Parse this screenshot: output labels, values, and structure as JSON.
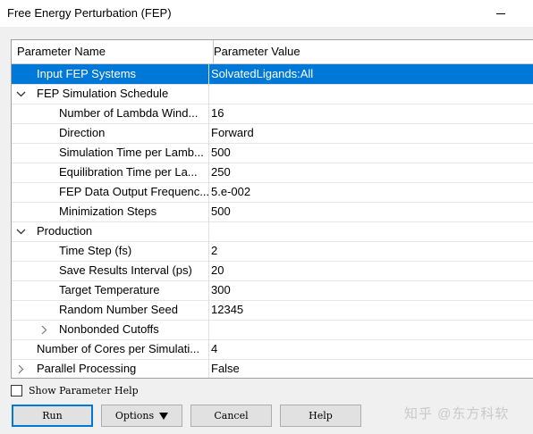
{
  "window": {
    "title": "Free Energy Perturbation (FEP)"
  },
  "table": {
    "headers": {
      "name": "Parameter Name",
      "value": "Parameter Value"
    },
    "rows": [
      {
        "name": "Input FEP Systems",
        "value": "SolvatedLigands:All",
        "selected": true
      },
      {
        "name": "FEP Simulation Schedule",
        "value": "",
        "group": "expanded"
      },
      {
        "name": "Number of Lambda Wind...",
        "value": "16"
      },
      {
        "name": "Direction",
        "value": "Forward"
      },
      {
        "name": "Simulation Time per Lamb...",
        "value": "500"
      },
      {
        "name": "Equilibration Time per La...",
        "value": "250"
      },
      {
        "name": "FEP Data Output Frequenc...",
        "value": "5.e-002"
      },
      {
        "name": "Minimization Steps",
        "value": "500"
      },
      {
        "name": "Production",
        "value": "",
        "group": "expanded"
      },
      {
        "name": "Time Step (fs)",
        "value": "2"
      },
      {
        "name": "Save Results Interval (ps)",
        "value": "20"
      },
      {
        "name": "Target Temperature",
        "value": "300"
      },
      {
        "name": "Random Number Seed",
        "value": "12345"
      },
      {
        "name": "Nonbonded Cutoffs",
        "value": "",
        "group": "collapsed"
      },
      {
        "name": "Number of Cores per Simulati...",
        "value": "4"
      },
      {
        "name": "Parallel Processing",
        "value": "False",
        "group": "collapsed"
      }
    ]
  },
  "show_help": {
    "label": "Show Parameter Help",
    "checked": false
  },
  "buttons": {
    "run": "Run",
    "options": "Options",
    "cancel": "Cancel",
    "help": "Help"
  },
  "watermark": "知乎 @东方科软",
  "colors": {
    "selection": "#0078d7",
    "default_button_border": "#0078d7"
  }
}
